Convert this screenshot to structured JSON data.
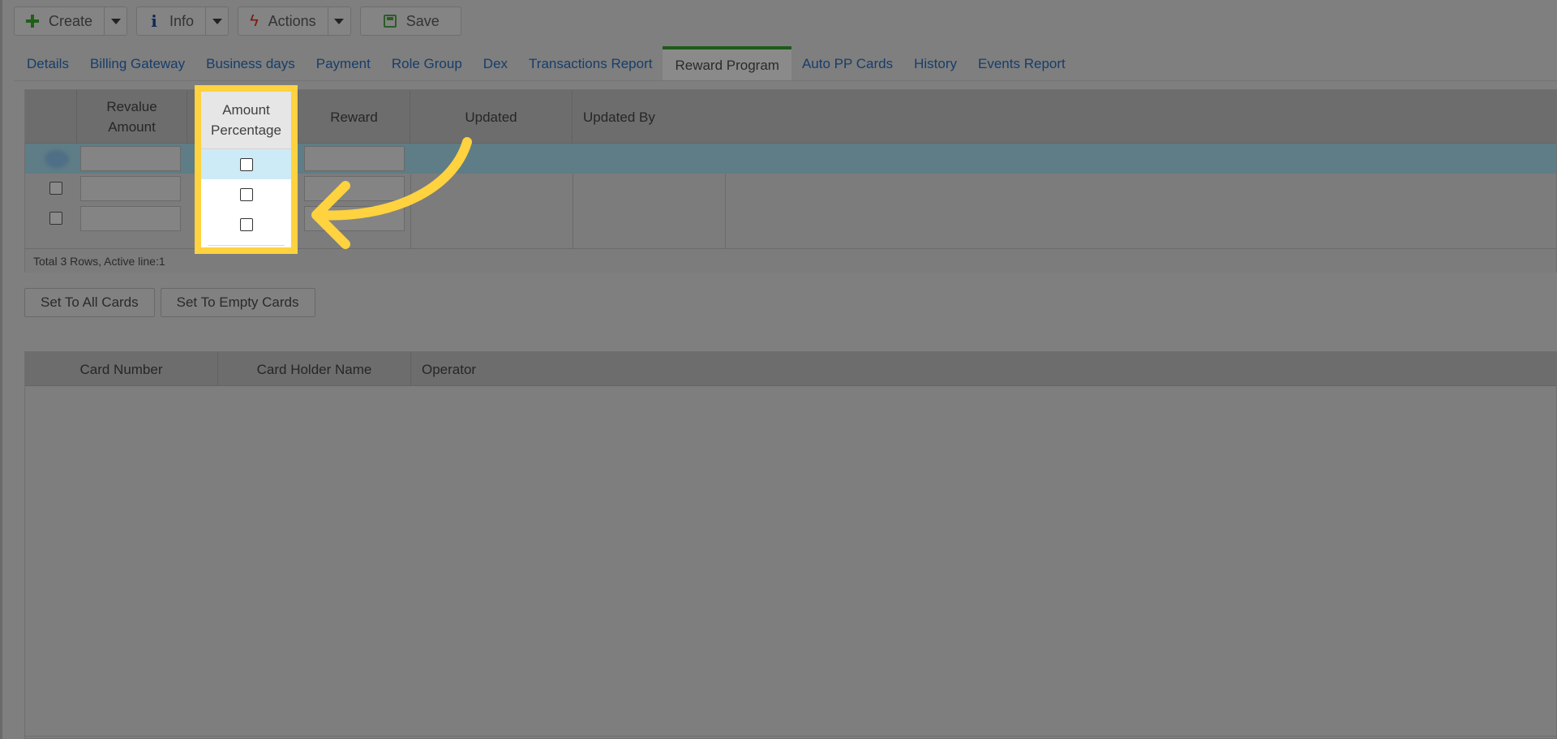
{
  "toolbar": {
    "create_label": "Create",
    "info_label": "Info",
    "actions_label": "Actions",
    "save_label": "Save"
  },
  "tabs": [
    {
      "label": "Details"
    },
    {
      "label": "Billing Gateway"
    },
    {
      "label": "Business days"
    },
    {
      "label": "Payment"
    },
    {
      "label": "Role Group"
    },
    {
      "label": "Dex"
    },
    {
      "label": "Transactions Report"
    },
    {
      "label": "Reward Program",
      "active": true
    },
    {
      "label": "Auto PP Cards"
    },
    {
      "label": "History"
    },
    {
      "label": "Events Report"
    }
  ],
  "reward_grid": {
    "columns": [
      "Revalue Amount",
      "Amount Percentage",
      "Reward",
      "Updated",
      "Updated By"
    ],
    "rows": [
      {
        "selected": true,
        "amount_percentage_checked": false
      },
      {
        "selected": false,
        "amount_percentage_checked": false
      },
      {
        "selected": false,
        "amount_percentage_checked": false
      }
    ],
    "footer": "Total 3 Rows, Active line:1"
  },
  "buttons": {
    "set_all": "Set To All Cards",
    "set_empty": "Set To Empty Cards"
  },
  "cards_grid": {
    "columns": [
      "Card Number",
      "Card Holder Name",
      "Operator"
    ]
  },
  "colors": {
    "highlight": "#ffd23f",
    "active_tab_accent": "#1d5a1a",
    "selected_row": "#cdebf6"
  }
}
